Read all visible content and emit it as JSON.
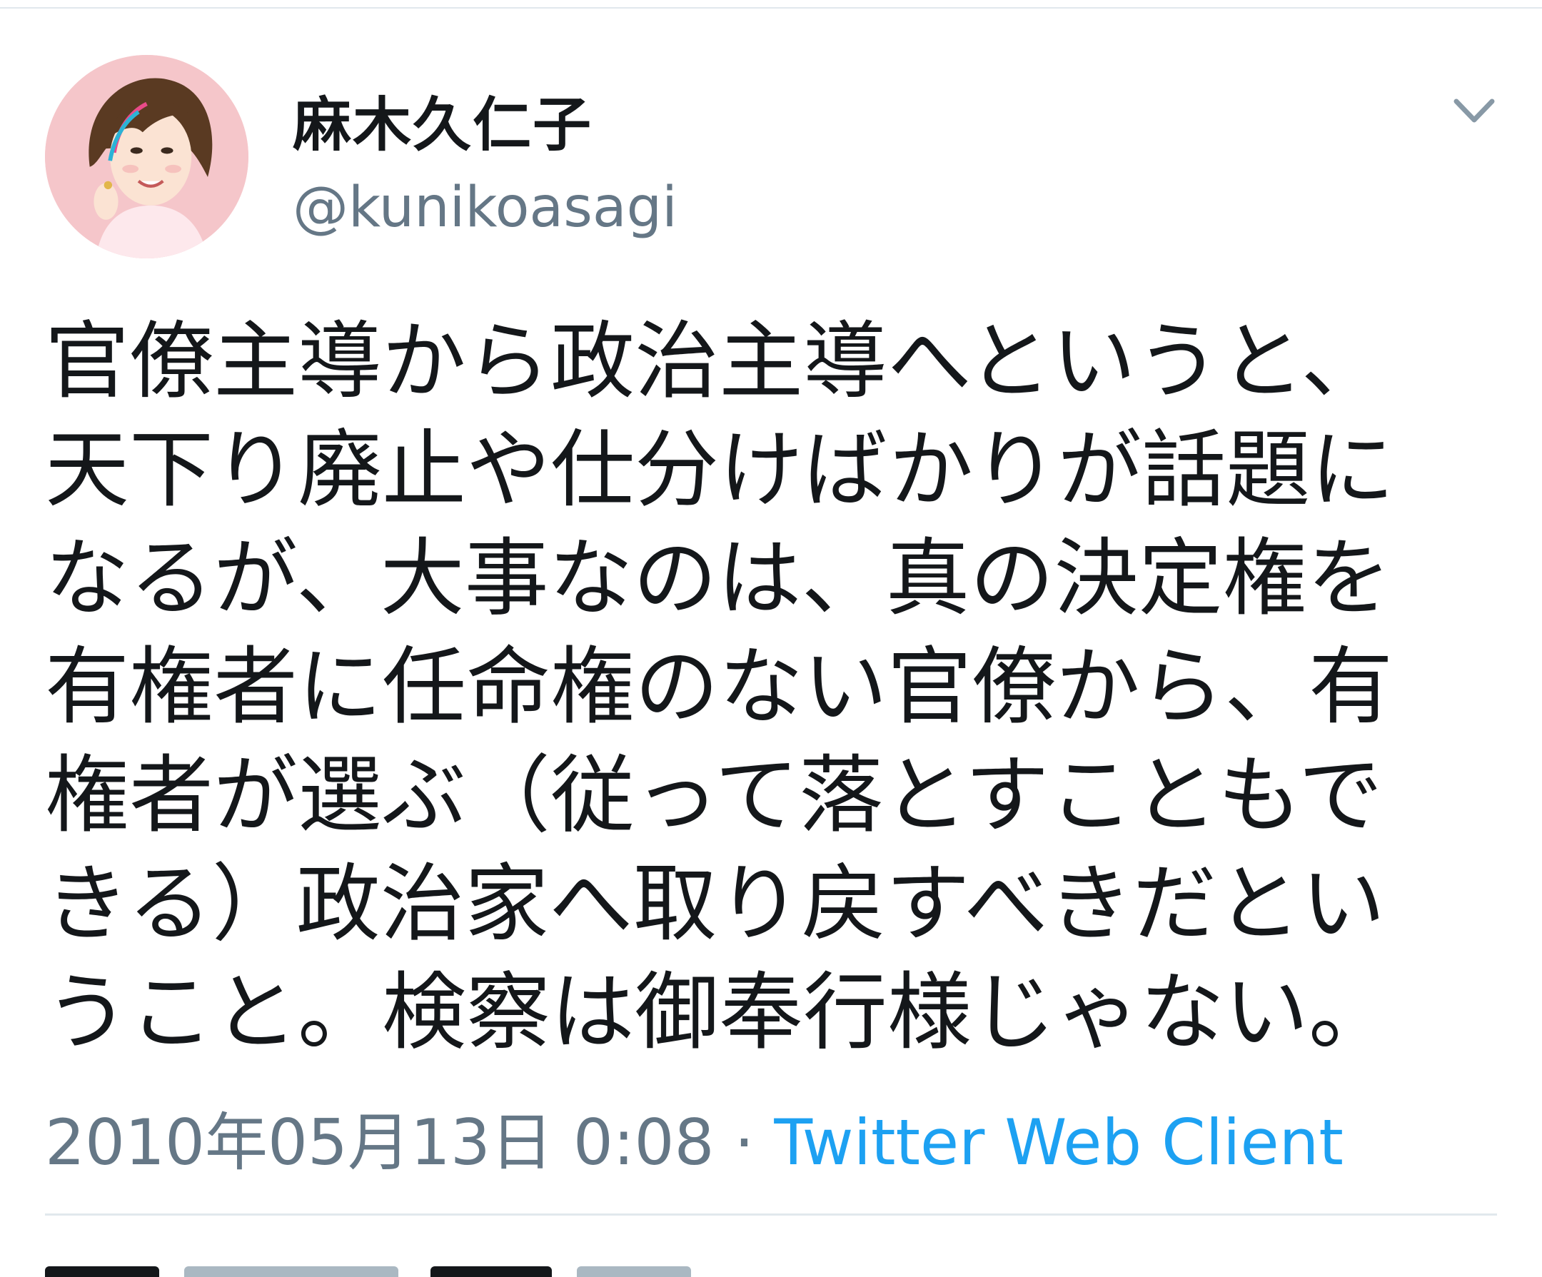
{
  "user": {
    "display_name": "麻木久仁子",
    "handle": "@kunikoasagi"
  },
  "tweet": {
    "text": "官僚主導から政治主導へというと、\n天下り廃止や仕分けばかりが話題に\nなるが、大事なのは、真の決定権を\n有権者に任命権のない官僚から、有\n権者が選ぶ（従って落とすこともで\nきる）政治家へ取り戻すべきだとい\nうこと。検察は御奉行様じゃない。",
    "timestamp": "2010年05月13日 0:08",
    "separator": " · ",
    "source": "Twitter Web Client"
  },
  "icons": {
    "menu": "chevron-down-icon",
    "avatar": "avatar"
  },
  "colors": {
    "text": "#14171a",
    "secondary": "#657786",
    "link": "#1da1f2",
    "divider": "#e1e8ed"
  }
}
